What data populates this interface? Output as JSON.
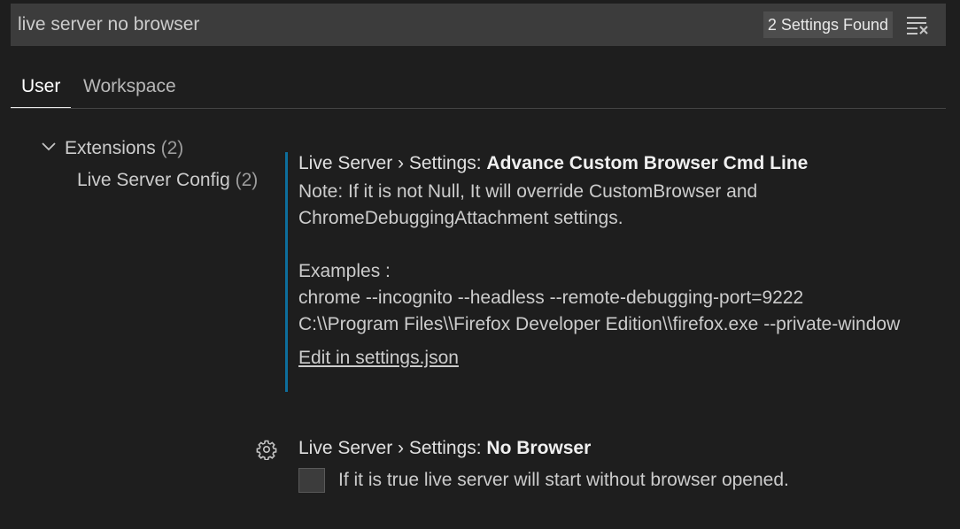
{
  "search": {
    "value": "live server no browser",
    "result_count": "2 Settings Found",
    "clear_icon": "clear-filter-icon"
  },
  "tabs": [
    {
      "label": "User",
      "active": true
    },
    {
      "label": "Workspace",
      "active": false
    }
  ],
  "toc": {
    "extensions": {
      "label": "Extensions",
      "count": "(2)",
      "icon": "chevron-down-icon"
    },
    "live_server_config": {
      "label": "Live Server Config",
      "count": "(2)"
    }
  },
  "settings": [
    {
      "category": "Live Server › Settings: ",
      "name": "Advance Custom Browser Cmd Line",
      "description": [
        "Note: If it is not Null, It will override CustomBrowser and",
        "ChromeDebuggingAttachment settings.",
        "",
        "Examples :",
        "chrome --incognito --headless --remote-debugging-port=9222",
        "C:\\\\Program Files\\\\Firefox Developer Edition\\\\firefox.exe --private-window"
      ],
      "link": "Edit in settings.json"
    },
    {
      "category": "Live Server › Settings: ",
      "name": "No Browser",
      "checkbox_label": "If it is true live server will start without browser opened.",
      "checked": false,
      "icon": "gear-icon"
    }
  ],
  "colors": {
    "background": "#1e1e1e",
    "input_background": "#3c3c3c",
    "focus_border": "#0e6e9c",
    "text": "#cccccc"
  }
}
